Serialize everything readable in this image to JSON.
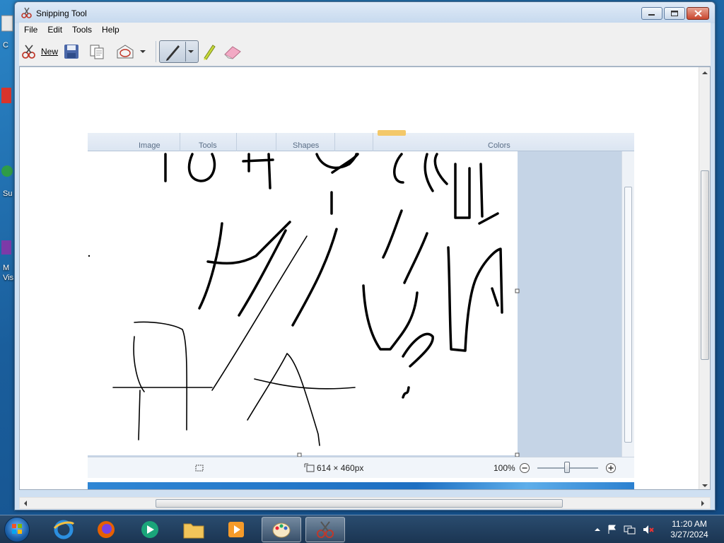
{
  "window": {
    "title": "Snipping Tool"
  },
  "menu": {
    "file": "File",
    "edit": "Edit",
    "tools": "Tools",
    "help": "Help"
  },
  "toolbar": {
    "new_label": "New"
  },
  "snip": {
    "ribbon_groups": {
      "image": "Image",
      "tools": "Tools",
      "shapes": "Shapes",
      "colors": "Colors"
    },
    "status": {
      "dimensions": "614 × 460px",
      "zoom": "100%"
    }
  },
  "desktop": {
    "label_1": "C",
    "label_2": "Su",
    "label_3": "M",
    "label_4": "Vis"
  },
  "taskbar": {
    "time": "11:20 AM",
    "date": "3/27/2024"
  }
}
